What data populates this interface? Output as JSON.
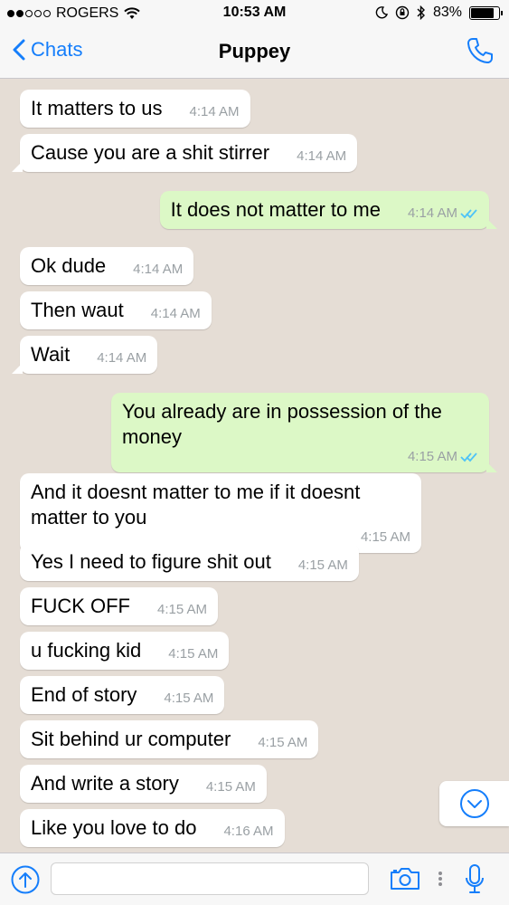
{
  "status": {
    "carrier": "ROGERS",
    "time": "10:53 AM",
    "battery": "83%",
    "battery_level": 0.83
  },
  "nav": {
    "back_label": "Chats",
    "title": "Puppey"
  },
  "messages": [
    {
      "text": "It matters to us",
      "time": "4:14 AM",
      "dir": "in"
    },
    {
      "text": "Cause you are a shit stirrer",
      "time": "4:14 AM",
      "dir": "in"
    },
    {
      "text": "It does not matter to me",
      "time": "4:14 AM",
      "dir": "out"
    },
    {
      "text": "Ok dude",
      "time": "4:14 AM",
      "dir": "in"
    },
    {
      "text": "Then waut",
      "time": "4:14 AM",
      "dir": "in"
    },
    {
      "text": "Wait",
      "time": "4:14 AM",
      "dir": "in"
    },
    {
      "text": "You already are in possession of the money",
      "time": "4:15 AM",
      "dir": "out"
    },
    {
      "text": "And it doesnt matter to me if it doesnt matter to you",
      "time": "4:15 AM",
      "dir": "in"
    },
    {
      "text": "Yes I need to figure shit out",
      "time": "4:15 AM",
      "dir": "in"
    },
    {
      "text": "FUCK OFF",
      "time": "4:15 AM",
      "dir": "in"
    },
    {
      "text": "u fucking kid",
      "time": "4:15 AM",
      "dir": "in"
    },
    {
      "text": "End of story",
      "time": "4:15 AM",
      "dir": "in"
    },
    {
      "text": "Sit behind ur computer",
      "time": "4:15 AM",
      "dir": "in"
    },
    {
      "text": "And write a story",
      "time": "4:15 AM",
      "dir": "in"
    },
    {
      "text": "Like you love to do",
      "time": "4:16 AM",
      "dir": "in"
    }
  ],
  "input": {
    "placeholder": ""
  },
  "colors": {
    "accent": "#157efb",
    "outgoing": "#dcf8c6",
    "incoming": "#ffffff",
    "chat_bg": "#e5ddd5",
    "read_ticks": "#4fc3f7"
  }
}
